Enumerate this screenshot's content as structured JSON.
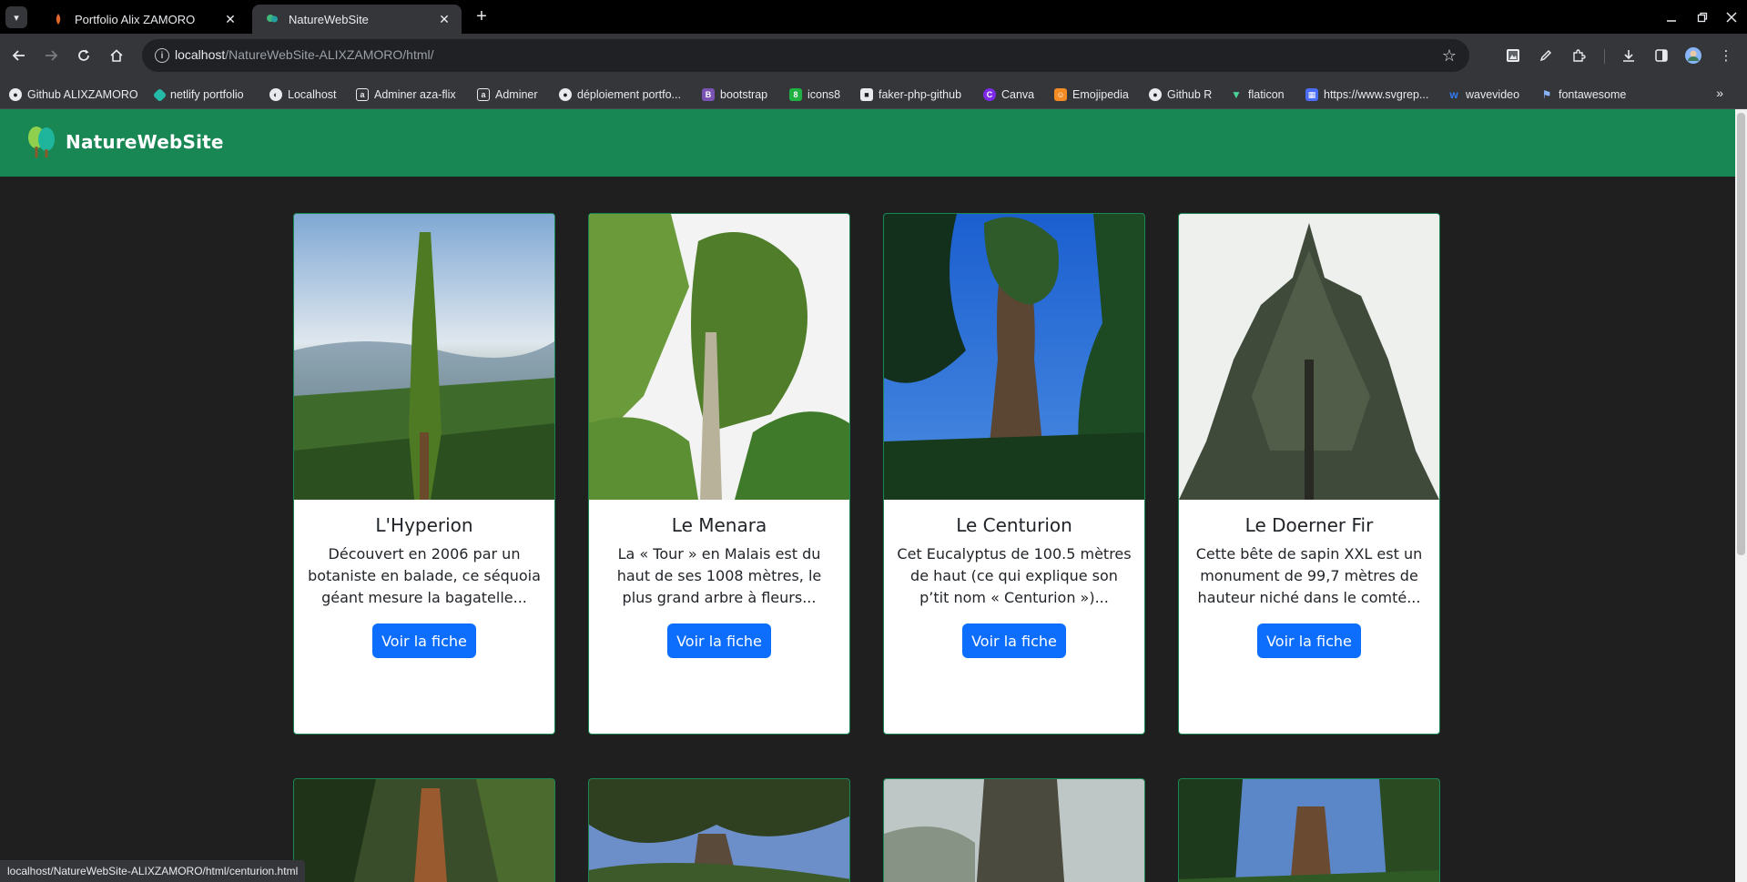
{
  "browser": {
    "tabs": [
      {
        "title": "Portfolio Alix ZAMORO",
        "active": false
      },
      {
        "title": "NatureWebSite",
        "active": true
      }
    ],
    "address": {
      "host": "localhost",
      "path": "/NatureWebSite-ALIXZAMORO/html/"
    },
    "bookmarks": [
      {
        "label": "Github ALIXZAMORO",
        "icon": "github-icon"
      },
      {
        "label": "netlify portfolio",
        "icon": "netlify-icon"
      },
      {
        "label": "Localhost",
        "icon": "globe-icon"
      },
      {
        "label": "Adminer aza-flix",
        "icon": "adminer-icon"
      },
      {
        "label": "Adminer",
        "icon": "adminer-icon"
      },
      {
        "label": "déploiement portfo...",
        "icon": "github-icon"
      },
      {
        "label": "bootstrap",
        "icon": "bootstrap-icon"
      },
      {
        "label": "icons8",
        "icon": "icons8-icon"
      },
      {
        "label": "faker-php-github",
        "icon": "faker-icon"
      },
      {
        "label": "Canva",
        "icon": "canva-icon"
      },
      {
        "label": "Emojipedia",
        "icon": "emojipedia-icon"
      },
      {
        "label": "Github R",
        "icon": "github-icon"
      },
      {
        "label": "flaticon",
        "icon": "flaticon-icon"
      },
      {
        "label": "https://www.svgrep...",
        "icon": "svgrepo-icon"
      },
      {
        "label": "wavevideo",
        "icon": "wavevideo-icon"
      },
      {
        "label": "fontawesome",
        "icon": "flag-icon"
      }
    ],
    "status_url": "localhost/NatureWebSite-ALIXZAMORO/html/centurion.html"
  },
  "site": {
    "brand": "NatureWebSite",
    "colors": {
      "navbar": "#198754",
      "button": "#0d6efd",
      "background": "#1e1f1e"
    },
    "cards": [
      {
        "title": "L'Hyperion",
        "description": "Découvert en 2006 par un botaniste en balade, ce séquoia géant mesure la bagatelle...",
        "button": "Voir la fiche"
      },
      {
        "title": "Le Menara",
        "description": "La « Tour » en Malais est du haut de ses 1008 mètres, le plus grand arbre à fleurs...",
        "button": "Voir la fiche"
      },
      {
        "title": "Le Centurion",
        "description": "Cet Eucalyptus de 100.5 mètres de haut (ce qui explique son p’tit nom « Centurion »)...",
        "button": "Voir la fiche"
      },
      {
        "title": "Le Doerner Fir",
        "description": "Cette bête de sapin XXL est un monument de 99,7 mètres de hauteur niché dans le comté...",
        "button": "Voir la fiche"
      }
    ]
  }
}
